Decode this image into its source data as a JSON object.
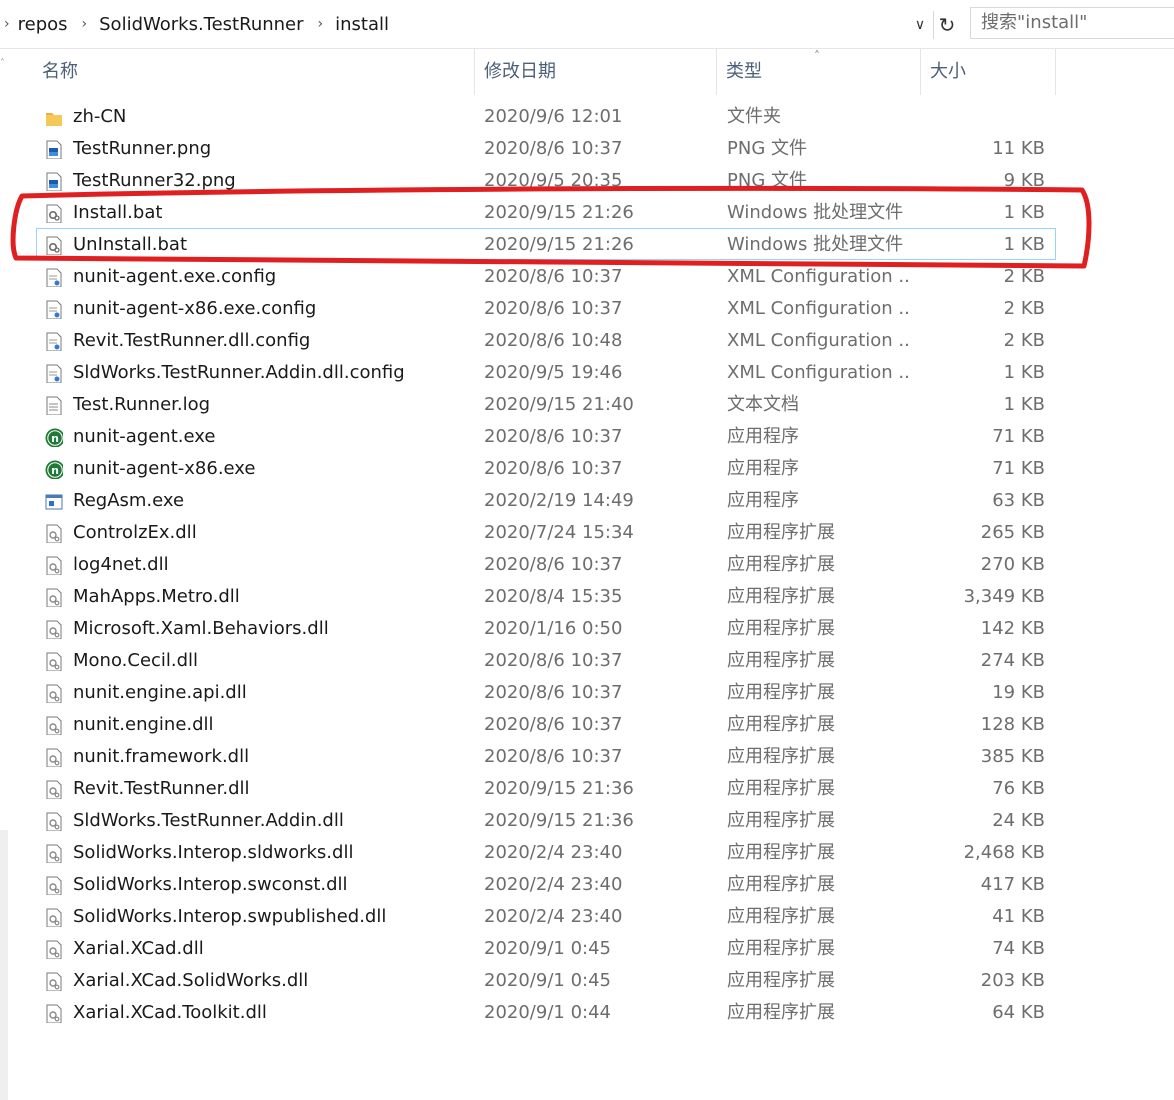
{
  "breadcrumb": [
    "repos",
    "SolidWorks.TestRunner",
    "install"
  ],
  "search": {
    "placeholder": "搜索\"install\""
  },
  "columns": {
    "name": "名称",
    "date": "修改日期",
    "type": "类型",
    "size": "大小"
  },
  "colors": {
    "folder": "#e8b33c",
    "nunit": "#1f7a35",
    "highlight": "#e02020"
  },
  "files": [
    {
      "name": "zh-CN",
      "date": "2020/9/6 12:01",
      "type": "文件夹",
      "size": "",
      "icon": "folder"
    },
    {
      "name": "TestRunner.png",
      "date": "2020/8/6 10:37",
      "type": "PNG 文件",
      "size": "11 KB",
      "icon": "image"
    },
    {
      "name": "TestRunner32.png",
      "date": "2020/9/5 20:35",
      "type": "PNG 文件",
      "size": "9 KB",
      "icon": "image"
    },
    {
      "name": "Install.bat",
      "date": "2020/9/15 21:26",
      "type": "Windows 批处理文件",
      "size": "1 KB",
      "icon": "gear"
    },
    {
      "name": "UnInstall.bat",
      "date": "2020/9/15 21:26",
      "type": "Windows 批处理文件",
      "size": "1 KB",
      "icon": "gear"
    },
    {
      "name": "nunit-agent.exe.config",
      "date": "2020/8/6 10:37",
      "type": "XML Configuration ...",
      "size": "2 KB",
      "icon": "config"
    },
    {
      "name": "nunit-agent-x86.exe.config",
      "date": "2020/8/6 10:37",
      "type": "XML Configuration ...",
      "size": "2 KB",
      "icon": "config"
    },
    {
      "name": "Revit.TestRunner.dll.config",
      "date": "2020/8/6 10:48",
      "type": "XML Configuration ...",
      "size": "2 KB",
      "icon": "config"
    },
    {
      "name": "SldWorks.TestRunner.Addin.dll.config",
      "date": "2020/9/5 19:46",
      "type": "XML Configuration ...",
      "size": "1 KB",
      "icon": "config"
    },
    {
      "name": "Test.Runner.log",
      "date": "2020/9/15 21:40",
      "type": "文本文档",
      "size": "1 KB",
      "icon": "text"
    },
    {
      "name": "nunit-agent.exe",
      "date": "2020/8/6 10:37",
      "type": "应用程序",
      "size": "71 KB",
      "icon": "nunit"
    },
    {
      "name": "nunit-agent-x86.exe",
      "date": "2020/8/6 10:37",
      "type": "应用程序",
      "size": "71 KB",
      "icon": "nunit"
    },
    {
      "name": "RegAsm.exe",
      "date": "2020/2/19 14:49",
      "type": "应用程序",
      "size": "63 KB",
      "icon": "app"
    },
    {
      "name": "ControlzEx.dll",
      "date": "2020/7/24 15:34",
      "type": "应用程序扩展",
      "size": "265 KB",
      "icon": "dll"
    },
    {
      "name": "log4net.dll",
      "date": "2020/8/6 10:37",
      "type": "应用程序扩展",
      "size": "270 KB",
      "icon": "dll"
    },
    {
      "name": "MahApps.Metro.dll",
      "date": "2020/8/4 15:35",
      "type": "应用程序扩展",
      "size": "3,349 KB",
      "icon": "dll"
    },
    {
      "name": "Microsoft.Xaml.Behaviors.dll",
      "date": "2020/1/16 0:50",
      "type": "应用程序扩展",
      "size": "142 KB",
      "icon": "dll"
    },
    {
      "name": "Mono.Cecil.dll",
      "date": "2020/8/6 10:37",
      "type": "应用程序扩展",
      "size": "274 KB",
      "icon": "dll"
    },
    {
      "name": "nunit.engine.api.dll",
      "date": "2020/8/6 10:37",
      "type": "应用程序扩展",
      "size": "19 KB",
      "icon": "dll"
    },
    {
      "name": "nunit.engine.dll",
      "date": "2020/8/6 10:37",
      "type": "应用程序扩展",
      "size": "128 KB",
      "icon": "dll"
    },
    {
      "name": "nunit.framework.dll",
      "date": "2020/8/6 10:37",
      "type": "应用程序扩展",
      "size": "385 KB",
      "icon": "dll"
    },
    {
      "name": "Revit.TestRunner.dll",
      "date": "2020/9/15 21:36",
      "type": "应用程序扩展",
      "size": "76 KB",
      "icon": "dll"
    },
    {
      "name": "SldWorks.TestRunner.Addin.dll",
      "date": "2020/9/15 21:36",
      "type": "应用程序扩展",
      "size": "24 KB",
      "icon": "dll"
    },
    {
      "name": "SolidWorks.Interop.sldworks.dll",
      "date": "2020/2/4 23:40",
      "type": "应用程序扩展",
      "size": "2,468 KB",
      "icon": "dll"
    },
    {
      "name": "SolidWorks.Interop.swconst.dll",
      "date": "2020/2/4 23:40",
      "type": "应用程序扩展",
      "size": "417 KB",
      "icon": "dll"
    },
    {
      "name": "SolidWorks.Interop.swpublished.dll",
      "date": "2020/2/4 23:40",
      "type": "应用程序扩展",
      "size": "41 KB",
      "icon": "dll"
    },
    {
      "name": "Xarial.XCad.dll",
      "date": "2020/9/1 0:45",
      "type": "应用程序扩展",
      "size": "74 KB",
      "icon": "dll"
    },
    {
      "name": "Xarial.XCad.SolidWorks.dll",
      "date": "2020/9/1 0:45",
      "type": "应用程序扩展",
      "size": "203 KB",
      "icon": "dll"
    },
    {
      "name": "Xarial.XCad.Toolkit.dll",
      "date": "2020/9/1 0:44",
      "type": "应用程序扩展",
      "size": "64 KB",
      "icon": "dll"
    }
  ]
}
